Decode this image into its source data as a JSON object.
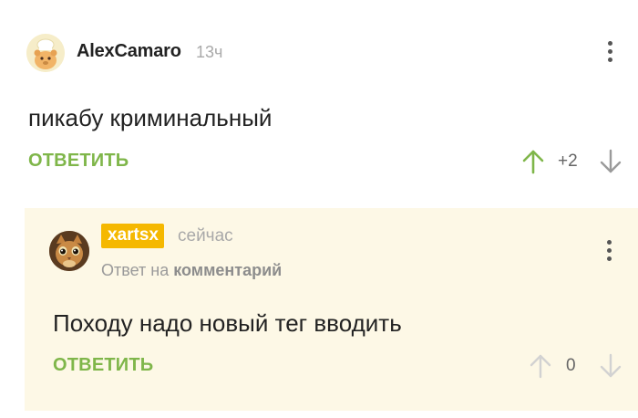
{
  "comments": [
    {
      "author": "AlexCamaro",
      "time": "13ч",
      "text": "пикабу криминальный",
      "reply_label": "ОТВЕТИТЬ",
      "rating": "+2",
      "avatar_icon": "chef-bear-avatar",
      "vote_up_color": "#7fb64a"
    },
    {
      "author": "xartsx",
      "time": "сейчас",
      "reply_to_prefix": "Ответ на",
      "reply_to_link": "комментарий",
      "text": "Походу надо новый тег вводить",
      "reply_label": "ОТВЕТИТЬ",
      "rating": "0",
      "avatar_icon": "cat-avatar",
      "author_badge_color": "#f5b800"
    }
  ],
  "colors": {
    "accent_green": "#7fb64a",
    "highlight_bg": "#fdf8e6",
    "muted_text": "#a9a9a9"
  }
}
